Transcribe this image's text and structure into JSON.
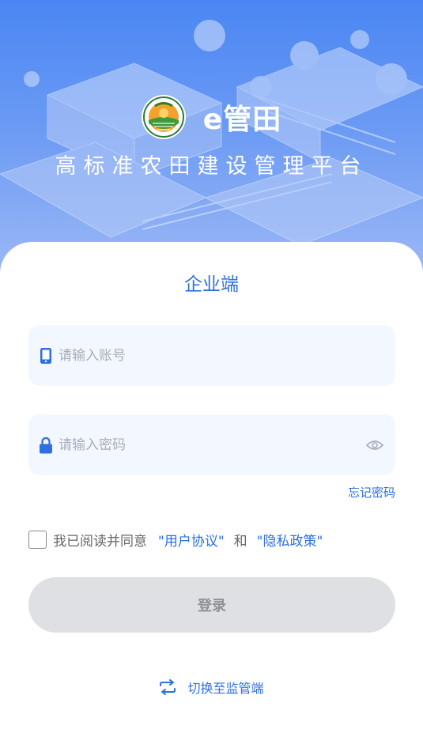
{
  "header": {
    "app_name": "e管田",
    "subtitle": "高标准农田建设管理平台"
  },
  "login": {
    "title": "企业端",
    "account_placeholder": "请输入账号",
    "password_placeholder": "请输入密码",
    "forgot_label": "忘记密码",
    "agree_text": "我已阅读并同意",
    "user_agreement_label": "\"用户协议\"",
    "and_text": "和",
    "privacy_label": "\"隐私政策\"",
    "login_label": "登录",
    "switch_label": "切换至监管端"
  },
  "icons": {
    "account": "phone-icon",
    "password": "lock-icon",
    "toggle_password": "eye-icon",
    "switch": "swap-icon"
  },
  "colors": {
    "accent": "#2f6fe0",
    "hero_top": "#4a86f3",
    "field_bg": "#f3f7ff",
    "button_disabled": "#dfe0e3"
  }
}
